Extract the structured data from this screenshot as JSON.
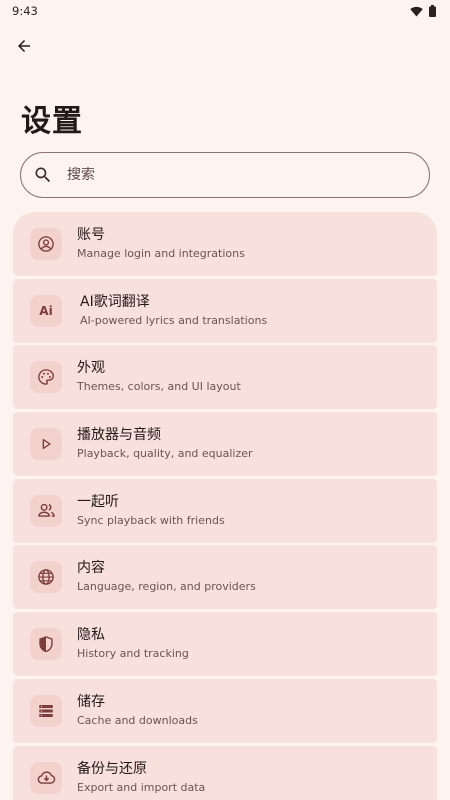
{
  "status_bar": {
    "time": "9:43"
  },
  "header": {
    "title": "设置"
  },
  "search": {
    "placeholder": "搜索",
    "value": ""
  },
  "colors": {
    "background": "#fdf4f2",
    "item_bg": "#f8e0dd",
    "icon_bg": "#f3d2ce",
    "accent": "#7b3c3d"
  },
  "settings": {
    "items": [
      {
        "icon": "account-circle-icon",
        "title": "账号",
        "subtitle": "Manage login and integrations"
      },
      {
        "icon": "ai-icon",
        "icon_text": "Ai",
        "title": "AI歌词翻译",
        "subtitle": "AI-powered lyrics and translations"
      },
      {
        "icon": "palette-icon",
        "title": "外观",
        "subtitle": "Themes, colors, and UI layout"
      },
      {
        "icon": "play-icon",
        "title": "播放器与音频",
        "subtitle": "Playback, quality, and equalizer"
      },
      {
        "icon": "group-icon",
        "title": "一起听",
        "subtitle": "Sync playback with friends"
      },
      {
        "icon": "globe-icon",
        "title": "内容",
        "subtitle": "Language, region, and providers"
      },
      {
        "icon": "shield-icon",
        "title": "隐私",
        "subtitle": "History and tracking"
      },
      {
        "icon": "storage-icon",
        "title": "储存",
        "subtitle": "Cache and downloads"
      },
      {
        "icon": "cloud-download-icon",
        "title": "备份与还原",
        "subtitle": "Export and import data"
      }
    ]
  }
}
